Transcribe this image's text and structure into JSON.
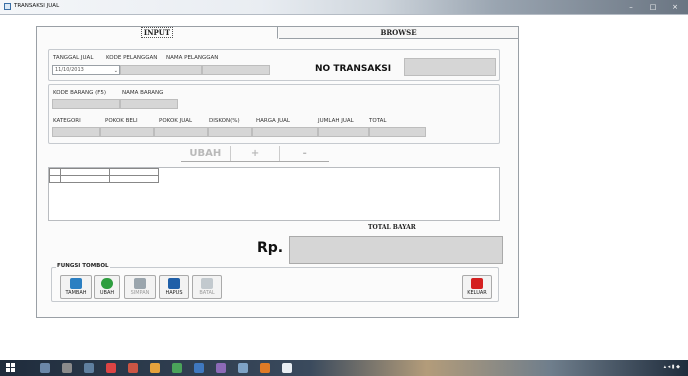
{
  "window": {
    "title": "TRANSAKSI JUAL",
    "controls": [
      "–",
      "□",
      "×"
    ]
  },
  "tabs": [
    {
      "label": "INPUT",
      "active": true
    },
    {
      "label": "BROWSE",
      "active": false
    }
  ],
  "header": {
    "tanggal_label": "TANGGAL JUAL",
    "kode_pelanggan_label": "KODE PELANGGAN",
    "nama_pelanggan_label": "NAMA PELANGGAN",
    "date_value": "11/10/2013",
    "no_transaksi_label": "NO TRANSAKSI"
  },
  "item": {
    "kode_barang_label": "KODE BARANG (F5)",
    "nama_barang_label": "NAMA BARANG",
    "kategori_label": "KATEGORI",
    "pokok_beli_label": "POKOK BELI",
    "pokok_jual_label": "POKOK JUAL",
    "diskon_label": "DISKON(%)",
    "harga_jual_label": "HARGA JUAL",
    "jumlah_jual_label": "JUMLAH JUAL",
    "total_label": "TOTAL"
  },
  "actions": {
    "ubah": "UBAH",
    "plus": "+",
    "minus": "-"
  },
  "totals": {
    "total_bayar_label": "TOTAL BAYAR",
    "currency": "Rp."
  },
  "fungsi": {
    "legend": "FUNGSI TOMBOL",
    "buttons": [
      {
        "label": "TAMBAH",
        "icon": "add-doc-icon",
        "color": "#2a7fc2"
      },
      {
        "label": "UBAH",
        "icon": "refresh-icon",
        "color": "#2e9e3f"
      },
      {
        "label": "SIMPAN",
        "icon": "save-icon",
        "color": "#9aa5ad"
      },
      {
        "label": "HAPUS",
        "icon": "delete-icon",
        "color": "#1f5fa8"
      },
      {
        "label": "BATAL",
        "icon": "cancel-icon",
        "color": "#9aa5ad"
      },
      {
        "label": "KELUAR",
        "icon": "exit-icon",
        "color": "#d42020"
      }
    ]
  }
}
